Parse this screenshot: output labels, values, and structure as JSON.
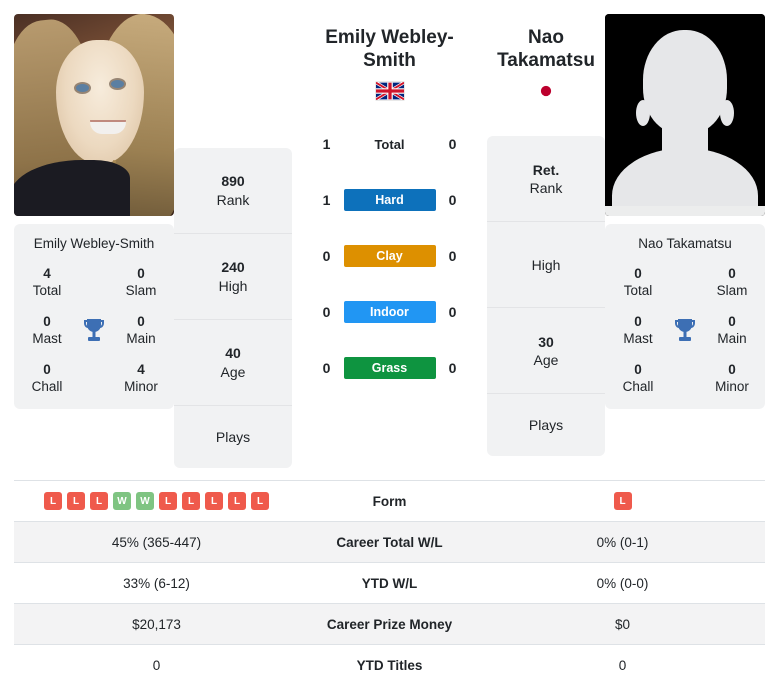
{
  "players": {
    "left": {
      "name": "Emily Webley-Smith",
      "display_name": "Emily Webley-Smith",
      "country": "Great Britain",
      "flag_icon": "flag-gb-icon",
      "photo_alt": "Emily Webley-Smith photo",
      "info": [
        {
          "value": "890",
          "label": "Rank"
        },
        {
          "value": "240",
          "label": "High"
        },
        {
          "value": "40",
          "label": "Age"
        },
        {
          "value": "",
          "label": "Plays"
        }
      ],
      "honours": [
        {
          "value": "4",
          "label": "Total"
        },
        {
          "value": "0",
          "label": "Slam"
        },
        {
          "value": "0",
          "label": "Mast"
        },
        {
          "value": "0",
          "label": "Main"
        },
        {
          "value": "0",
          "label": "Chall"
        },
        {
          "value": "4",
          "label": "Minor"
        }
      ]
    },
    "right": {
      "name": "Nao Takamatsu",
      "display_name": "Nao Takamatsu",
      "country": "Japan",
      "flag_icon": "flag-jp-icon",
      "photo_alt": "Nao Takamatsu placeholder avatar",
      "info": [
        {
          "value": "Ret.",
          "label": "Rank"
        },
        {
          "value": "",
          "label": "High"
        },
        {
          "value": "30",
          "label": "Age"
        },
        {
          "value": "",
          "label": "Plays"
        }
      ],
      "honours": [
        {
          "value": "0",
          "label": "Total"
        },
        {
          "value": "0",
          "label": "Slam"
        },
        {
          "value": "0",
          "label": "Mast"
        },
        {
          "value": "0",
          "label": "Main"
        },
        {
          "value": "0",
          "label": "Chall"
        },
        {
          "value": "0",
          "label": "Minor"
        }
      ]
    }
  },
  "head_to_head": [
    {
      "label": "Total",
      "left": "1",
      "right": "0",
      "color": "",
      "style": "plain"
    },
    {
      "label": "Hard",
      "left": "1",
      "right": "0",
      "color": "#0d71bb",
      "style": "pill"
    },
    {
      "label": "Clay",
      "left": "0",
      "right": "0",
      "color": "#dd9000",
      "style": "pill"
    },
    {
      "label": "Indoor",
      "left": "0",
      "right": "0",
      "color": "#2196f3",
      "style": "pill"
    },
    {
      "label": "Grass",
      "left": "0",
      "right": "0",
      "color": "#0e9440",
      "style": "pill"
    }
  ],
  "trophy_icon": "trophy-icon",
  "trophy_color": "#3d6fb4",
  "comparison_rows": [
    {
      "label": "Form",
      "type": "form",
      "left_form": [
        "L",
        "L",
        "L",
        "W",
        "W",
        "L",
        "L",
        "L",
        "L",
        "L"
      ],
      "right_form": [
        "L"
      ],
      "left": "",
      "right": "",
      "striped": false
    },
    {
      "label": "Career Total W/L",
      "type": "text",
      "left": "45% (365-447)",
      "right": "0% (0-1)",
      "striped": true
    },
    {
      "label": "YTD W/L",
      "type": "text",
      "left": "33% (6-12)",
      "right": "0% (0-0)",
      "striped": false
    },
    {
      "label": "Career Prize Money",
      "type": "text",
      "left": "$20,173",
      "right": "$0",
      "striped": true
    },
    {
      "label": "YTD Titles",
      "type": "text",
      "left": "0",
      "right": "0",
      "striped": false
    }
  ],
  "colors": {
    "hard": "#0d71bb",
    "clay": "#dd9000",
    "indoor": "#2196f3",
    "grass": "#0e9440",
    "win_badge": "#7fc482",
    "loss_badge": "#ef5a4c",
    "card_bg": "#f1f2f3",
    "row_stripe": "#f3f3f4"
  }
}
